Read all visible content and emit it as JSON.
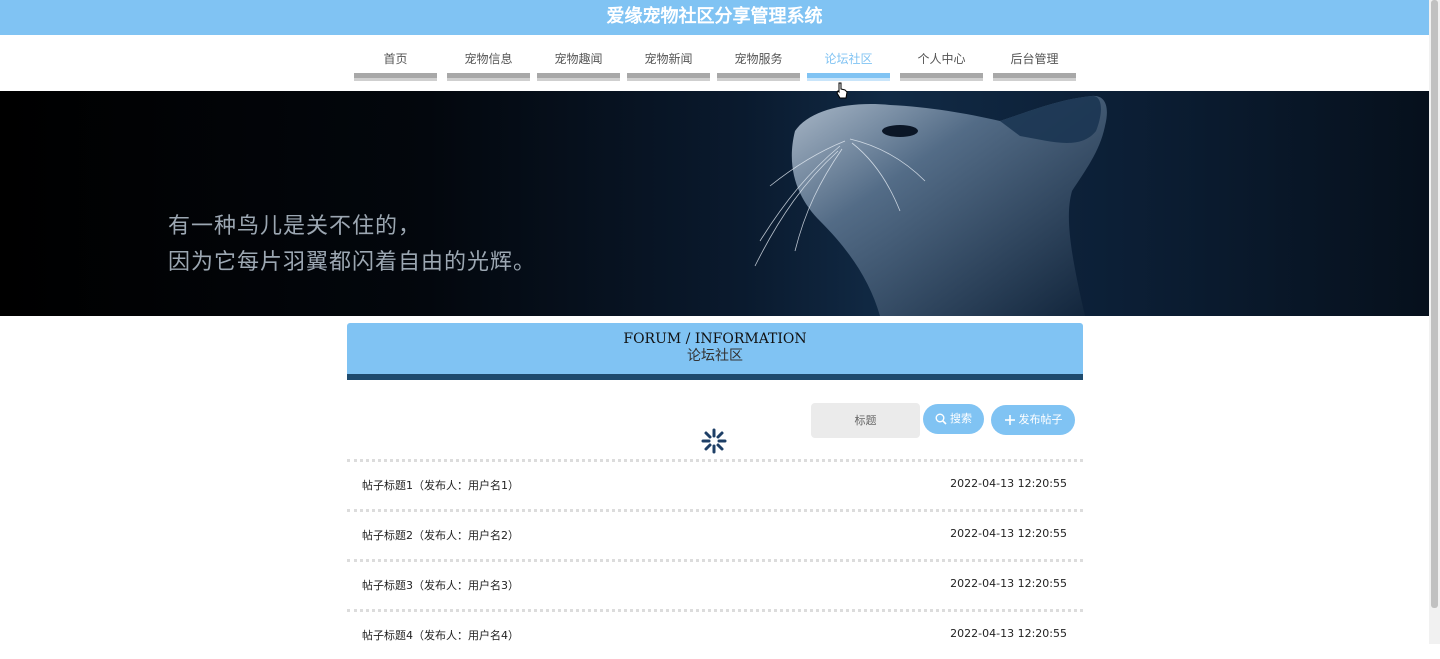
{
  "app": {
    "title": "爱缘宠物社区分享管理系统"
  },
  "nav": {
    "items": [
      {
        "label": "首页"
      },
      {
        "label": "宠物信息"
      },
      {
        "label": "宠物趣闻"
      },
      {
        "label": "宠物新闻"
      },
      {
        "label": "宠物服务"
      },
      {
        "label": "论坛社区",
        "active": true
      },
      {
        "label": "个人中心"
      },
      {
        "label": "后台管理"
      }
    ]
  },
  "banner": {
    "line1": "有一种鸟儿是关不住的，",
    "line2": "因为它每片羽翼都闪着自由的光辉。"
  },
  "section": {
    "title_en": "FORUM / INFORMATION",
    "title_cn": "论坛社区"
  },
  "search": {
    "placeholder": "标题",
    "search_label": "搜索",
    "post_label": "发布帖子"
  },
  "posts": [
    {
      "title": "帖子标题1（发布人：用户名1）",
      "time": "2022-04-13 12:20:55"
    },
    {
      "title": "帖子标题2（发布人：用户名2）",
      "time": "2022-04-13 12:20:55"
    },
    {
      "title": "帖子标题3（发布人：用户名3）",
      "time": "2022-04-13 12:20:55"
    },
    {
      "title": "帖子标题4（发布人：用户名4）",
      "time": "2022-04-13 12:20:55"
    }
  ],
  "colors": {
    "accent": "#80c3f3",
    "dark_bar": "#1e4a6d"
  }
}
